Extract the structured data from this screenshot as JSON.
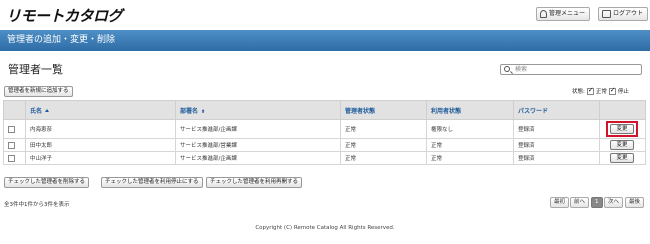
{
  "header": {
    "logo": "リモートカタログ",
    "admin_menu": "管理メニュー",
    "logout": "ログアウト"
  },
  "pagebar": {
    "title": "管理者の追加・変更・削除"
  },
  "section": {
    "title": "管理者一覧"
  },
  "search": {
    "placeholder": "検索"
  },
  "toolbar": {
    "add_new": "管理者を新規に追加する"
  },
  "status_filter": {
    "label": "状態:",
    "options": [
      {
        "label": "正常",
        "checked": true
      },
      {
        "label": "停止",
        "checked": true
      }
    ]
  },
  "table": {
    "columns": [
      "",
      "氏名",
      "部署名",
      "管理者状態",
      "利用者状態",
      "パスワード",
      ""
    ],
    "rows": [
      {
        "name": "内海恵奈",
        "dept": "サービス推進部/企画課",
        "admin_state": "正常",
        "user_state": "権限なし",
        "password": "登録済",
        "action": "変更"
      },
      {
        "name": "田中太郎",
        "dept": "サービス推進部/営業課",
        "admin_state": "正常",
        "user_state": "正常",
        "password": "登録済",
        "action": "変更"
      },
      {
        "name": "中山洋子",
        "dept": "サービス推進部/企画課",
        "admin_state": "正常",
        "user_state": "正常",
        "password": "登録済",
        "action": "変更"
      }
    ]
  },
  "bulk_actions": {
    "delete": "チェックした管理者を削除する",
    "suspend": "チェックした管理者を利用停止にする",
    "resume": "チェックした管理者を利用再開する"
  },
  "footer": {
    "count": "全3件中1件から3件を表示",
    "pager": {
      "first": "最初",
      "prev": "前へ",
      "current": "1",
      "next": "次へ",
      "last": "最後"
    },
    "copyright": "Copyright (C) Remote Catalog All Rights Reserved."
  }
}
